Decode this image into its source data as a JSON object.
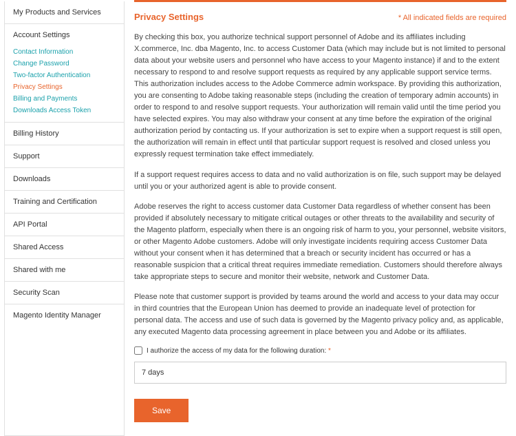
{
  "sidebar": {
    "items": [
      {
        "label": "My Products and Services"
      },
      {
        "label": "Account Settings"
      },
      {
        "label": "Billing History"
      },
      {
        "label": "Support"
      },
      {
        "label": "Downloads"
      },
      {
        "label": "Training and Certification"
      },
      {
        "label": "API Portal"
      },
      {
        "label": "Shared Access"
      },
      {
        "label": "Shared with me"
      },
      {
        "label": "Security Scan"
      },
      {
        "label": "Magento Identity Manager"
      }
    ],
    "sub_items": [
      {
        "label": "Contact Information"
      },
      {
        "label": "Change Password"
      },
      {
        "label": "Two-factor Authentication"
      },
      {
        "label": "Privacy Settings"
      },
      {
        "label": "Billing and Payments"
      },
      {
        "label": "Downloads Access Token"
      }
    ]
  },
  "header": {
    "title": "Privacy Settings",
    "required_note": "* All indicated fields are required"
  },
  "paragraphs": {
    "p1": "By checking this box, you authorize technical support personnel of Adobe and its affiliates including X.commerce, Inc. dba Magento, Inc. to access Customer Data (which may include but is not limited to personal data about your website users and personnel who have access to your Magento instance) if and to the extent necessary to respond to and resolve support requests as required by any applicable support service terms. This authorization includes access to the Adobe Commerce admin workspace. By providing this authorization, you are consenting to Adobe taking reasonable steps (including the creation of temporary admin accounts) in order to respond to and resolve support requests. Your authorization will remain valid until the time period you have selected expires. You may also withdraw your consent at any time before the expiration of the original authorization period by contacting us. If your authorization is set to expire when a support request is still open, the authorization will remain in effect until that particular support request is resolved and closed unless you expressly request termination take effect immediately.",
    "p2": "If a support request requires access to data and no valid authorization is on file, such support may be delayed until you or your authorized agent is able to provide consent.",
    "p3": "Adobe reserves the right to access customer data Customer Data regardless of whether consent has been provided if absolutely necessary to mitigate critical outages or other threats to the availability and security of the Magento platform, especially when there is an ongoing risk of harm to you, your personnel, website visitors, or other Magento Adobe customers. Adobe will only investigate incidents requiring access Customer Data without your consent when it has determined that a breach or security incident has occurred or has a reasonable suspicion that a critical threat requires immediate remediation. Customers should therefore always take appropriate steps to secure and monitor their website, network and Customer Data.",
    "p4": "Please note that customer support is provided by teams around the world and access to your data may occur in third countries that the European Union has deemed to provide an inadequate level of protection for personal data. The access and use of such data is governed by the Magento privacy policy and, as applicable, any executed Magento data processing agreement in place between you and Adobe or its affiliates."
  },
  "form": {
    "checkbox_label": "I authorize the access of my data for the following duration:",
    "asterisk": "*",
    "duration_value": "7 days",
    "save_label": "Save"
  }
}
